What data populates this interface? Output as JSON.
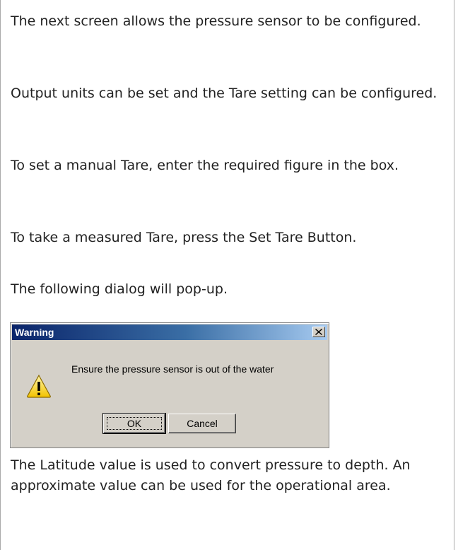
{
  "paragraphs": {
    "p1": "The next screen allows the pressure sensor to be configured.",
    "p2": "Output units can be set and the Tare setting can be configured.",
    "p3": "To set a manual Tare, enter the required figure in the box.",
    "p4": "To take a measured Tare, press the Set Tare Button.",
    "p5": "The following dialog will pop-up.",
    "p6": "The Latitude value is used to convert pressure to depth. An approximate value can be used for the operational area."
  },
  "dialog": {
    "title": "Warning",
    "message": "Ensure the pressure sensor is out of the water",
    "ok_label": "OK",
    "cancel_label": "Cancel",
    "icon": "warning-icon",
    "close_icon": "close-icon",
    "title_color": "#0a246a",
    "face_color": "#d4d0c8"
  }
}
